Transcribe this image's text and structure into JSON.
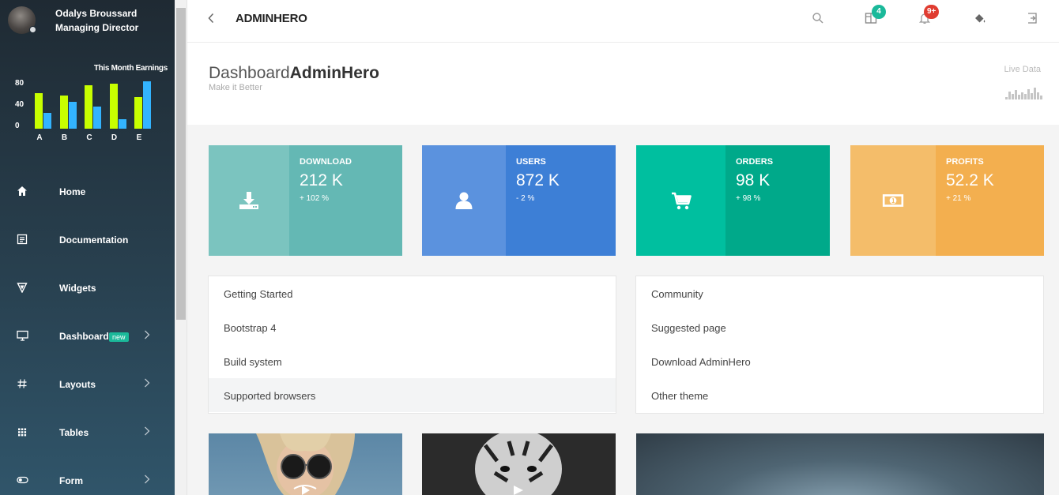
{
  "profile": {
    "name": "Odalys Broussard",
    "role": "Managing Director"
  },
  "earnings_chart": {
    "chart_data": {
      "type": "bar",
      "title": "This Month Earnings",
      "categories": [
        "A",
        "B",
        "C",
        "D",
        "E"
      ],
      "series": [
        {
          "values": [
            62,
            57,
            75,
            78,
            55
          ]
        },
        {
          "values": [
            27,
            46,
            38,
            17,
            82
          ]
        }
      ],
      "yticks": [
        "80",
        "40",
        "0"
      ],
      "ylim": [
        0,
        90
      ],
      "colors": [
        "#c8ff00",
        "#33b4ff"
      ]
    }
  },
  "sidebar": {
    "items": [
      {
        "label": "Home",
        "icon": "home-icon"
      },
      {
        "label": "Documentation",
        "icon": "document-icon"
      },
      {
        "label": "Widgets",
        "icon": "widgets-icon"
      },
      {
        "label": "Dashboard",
        "icon": "monitor-icon",
        "badge": "new",
        "has_children": true
      },
      {
        "label": "Layouts",
        "icon": "hash-icon",
        "has_children": true
      },
      {
        "label": "Tables",
        "icon": "grid-icon",
        "has_children": true
      },
      {
        "label": "Form",
        "icon": "toggle-icon",
        "has_children": true
      }
    ]
  },
  "header": {
    "brand": "ADMINHERO",
    "notifications": {
      "apps_count": "4",
      "bell_count": "9+"
    },
    "colors": {
      "apps_badge": "#1bb99a",
      "bell_badge": "#e03c31"
    }
  },
  "page": {
    "title_light": "Dashboard",
    "title_bold": "AdminHero",
    "subtitle": "Make it Better",
    "live_label": "Live Data"
  },
  "stats": [
    {
      "label": "DOWNLOAD",
      "value": "212 K",
      "change": "+ 102 %",
      "icon": "download-icon",
      "color_dark": "#64b8b4",
      "color_light": "#7bc4bf"
    },
    {
      "label": "USERS",
      "value": "872 K",
      "change": "- 2 %",
      "icon": "user-icon",
      "color_dark": "#3d7fd6",
      "color_light": "#5b92de"
    },
    {
      "label": "ORDERS",
      "value": "98 K",
      "change": "+ 98 %",
      "icon": "cart-icon",
      "color_dark": "#00a98a",
      "color_light": "#00bf9f"
    },
    {
      "label": "PROFITS",
      "value": "52.2 K",
      "change": "+ 21 %",
      "icon": "money-icon",
      "color_dark": "#f3af4f",
      "color_light": "#f4bd6a"
    }
  ],
  "docs_list": [
    "Getting Started",
    "Bootstrap 4",
    "Build system",
    "Supported browsers"
  ],
  "community_list": [
    "Community",
    "Suggested page",
    "Download AdminHero",
    "Other theme"
  ]
}
